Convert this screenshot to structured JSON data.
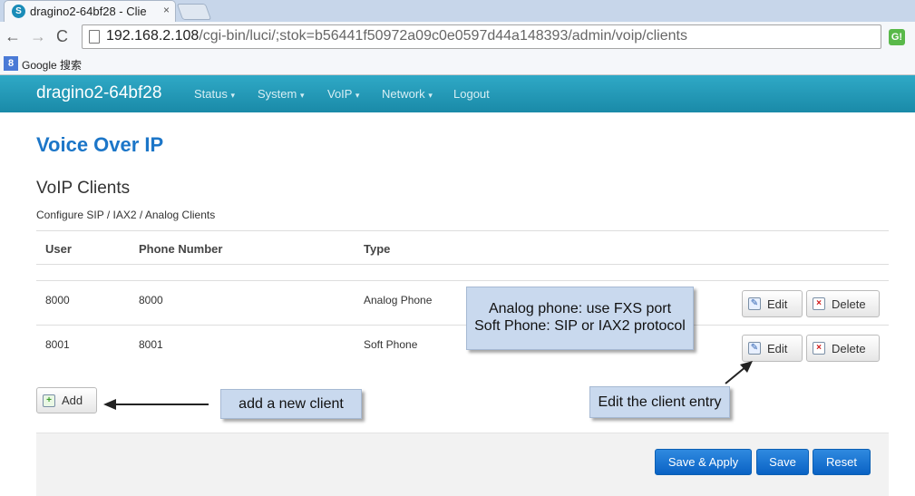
{
  "browser": {
    "tab_title": "dragino2-64bf28 - Clie",
    "tab_close": "×",
    "url_host": "192.168.2.108",
    "url_path": "/cgi-bin/luci/;stok=b56441f50972a09c0e0597d44a148393/admin/voip/clients",
    "back": "←",
    "forward": "→",
    "reload": "C",
    "star": "☆",
    "ext_label": "G!",
    "bookmark_icon": "8",
    "bookmark_label": "Google 搜索"
  },
  "header": {
    "brand": "dragino2-64bf28",
    "menu": [
      {
        "label": "Status",
        "has_dropdown": true
      },
      {
        "label": "System",
        "has_dropdown": true
      },
      {
        "label": "VoIP",
        "has_dropdown": true
      },
      {
        "label": "Network",
        "has_dropdown": true
      },
      {
        "label": "Logout",
        "has_dropdown": false
      }
    ],
    "caret": "▾"
  },
  "page": {
    "title": "Voice Over IP",
    "section_title": "VoIP Clients",
    "section_desc": "Configure SIP / IAX2 / Analog Clients"
  },
  "table": {
    "headers": [
      "User",
      "Phone Number",
      "Type"
    ],
    "rows": [
      {
        "user": "8000",
        "phone": "8000",
        "type": "Analog Phone",
        "edit": "Edit",
        "delete": "Delete"
      },
      {
        "user": "8001",
        "phone": "8001",
        "type": "Soft Phone",
        "edit": "Edit",
        "delete": "Delete"
      }
    ],
    "add_label": "Add"
  },
  "footer": {
    "save_apply": "Save & Apply",
    "save": "Save",
    "reset": "Reset"
  },
  "callouts": {
    "type_line1": "Analog phone: use FXS port",
    "type_line2": "Soft Phone: SIP or IAX2 protocol",
    "add": "add a new client",
    "edit": "Edit the client entry"
  },
  "colors": {
    "navbar": "#1a8aa8",
    "title": "#1c76c8",
    "primary": "#0a62c4",
    "callout": "#c9d9ee"
  }
}
